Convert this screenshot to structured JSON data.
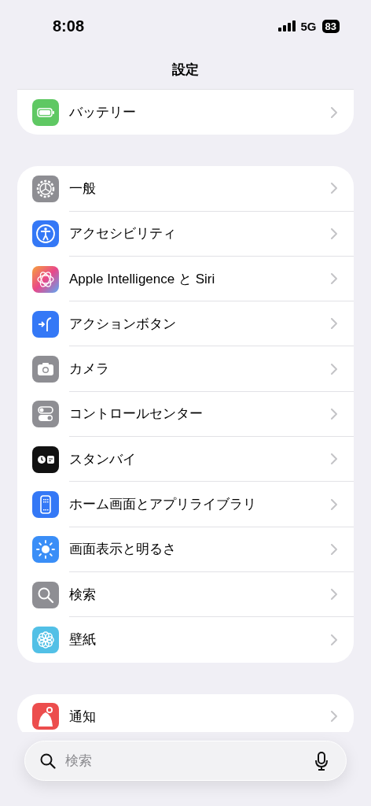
{
  "status_bar": {
    "time": "8:08",
    "network": "5G",
    "battery": "83"
  },
  "title": "設定",
  "sections": [
    {
      "rows": [
        {
          "label": "バッテリー",
          "kind": "battery"
        }
      ]
    },
    {
      "rows": [
        {
          "label": "一般",
          "kind": "gear"
        },
        {
          "label": "アクセシビリティ",
          "kind": "accessibility"
        },
        {
          "label": "Apple Intelligence と Siri",
          "kind": "intelligence"
        },
        {
          "label": "アクションボタン",
          "kind": "action"
        },
        {
          "label": "カメラ",
          "kind": "camera"
        },
        {
          "label": "コントロールセンター",
          "kind": "toggles"
        },
        {
          "label": "スタンバイ",
          "kind": "standby"
        },
        {
          "label": "ホーム画面とアプリライブラリ",
          "kind": "phone"
        },
        {
          "label": "画面表示と明るさ",
          "kind": "sun"
        },
        {
          "label": "検索",
          "kind": "search"
        },
        {
          "label": "壁紙",
          "kind": "flower"
        }
      ]
    },
    {
      "rows": [
        {
          "label": "通知",
          "kind": "bell"
        }
      ]
    }
  ],
  "search": {
    "placeholder": "検索"
  }
}
